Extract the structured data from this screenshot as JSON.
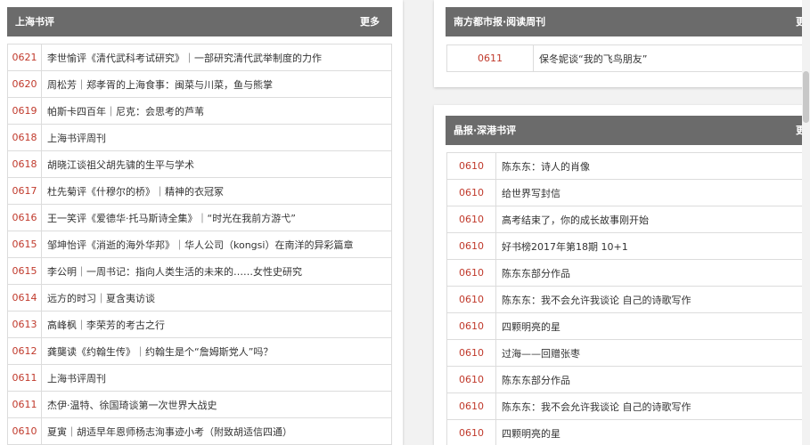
{
  "left": {
    "title": "上海书评",
    "more": "更多",
    "rows": [
      {
        "date": "0621",
        "title": "李世愉评《清代武科考试研究》｜一部研究清代武举制度的力作"
      },
      {
        "date": "0620",
        "title": "周松芳｜郑孝胥的上海食事：闽菜与川菜，鱼与熊掌"
      },
      {
        "date": "0619",
        "title": "帕斯卡四百年｜尼克：会思考的芦苇"
      },
      {
        "date": "0618",
        "title": "上海书评周刊"
      },
      {
        "date": "0618",
        "title": "胡晓江谈祖父胡先骕的生平与学术"
      },
      {
        "date": "0617",
        "title": "杜先菊评《什穆尔的桥》｜精神的衣冠冢"
      },
      {
        "date": "0616",
        "title": "王一笑评《爱德华·托马斯诗全集》｜“时光在我前方游弋”"
      },
      {
        "date": "0615",
        "title": "邹坤怡评《消逝的海外华邦》｜华人公司（kongsi）在南洋的异彩篇章"
      },
      {
        "date": "0615",
        "title": "李公明｜一周书记：指向人类生活的未来的……女性史研究"
      },
      {
        "date": "0614",
        "title": "远方的时习｜夏含夷访谈"
      },
      {
        "date": "0613",
        "title": "高峰枫｜李荣芳的考古之行"
      },
      {
        "date": "0612",
        "title": "龚龑读《约翰生传》｜约翰生是个“詹姆斯党人”吗？"
      },
      {
        "date": "0611",
        "title": "上海书评周刊"
      },
      {
        "date": "0611",
        "title": "杰伊·温特、徐国琦谈第一次世界大战史"
      },
      {
        "date": "0610",
        "title": "夏寅｜胡适早年恩师杨志洵事迹小考（附致胡适信四通）"
      }
    ]
  },
  "nanfang": {
    "title": "南方都市报·阅读周刊",
    "more": "更多",
    "rows": [
      {
        "date": "0611",
        "title": "保冬妮谈“我的飞鸟朋友”"
      }
    ]
  },
  "jingbao": {
    "title": "晶报·深港书评",
    "more": "更多",
    "rows": [
      {
        "date": "0610",
        "title": "陈东东：诗人的肖像"
      },
      {
        "date": "0610",
        "title": "给世界写封信"
      },
      {
        "date": "0610",
        "title": "高考结束了，你的成长故事刚开始"
      },
      {
        "date": "0610",
        "title": "好书榜2017年第18期 10+1"
      },
      {
        "date": "0610",
        "title": "陈东东部分作品"
      },
      {
        "date": "0610",
        "title": "陈东东：我不会允许我谈论 自己的诗歌写作"
      },
      {
        "date": "0610",
        "title": "四颗明亮的星"
      },
      {
        "date": "0610",
        "title": "过海——回赠张枣"
      },
      {
        "date": "0610",
        "title": "陈东东部分作品"
      },
      {
        "date": "0610",
        "title": "陈东东：我不会允许我谈论 自己的诗歌写作"
      },
      {
        "date": "0610",
        "title": "四颗明亮的星"
      }
    ]
  }
}
